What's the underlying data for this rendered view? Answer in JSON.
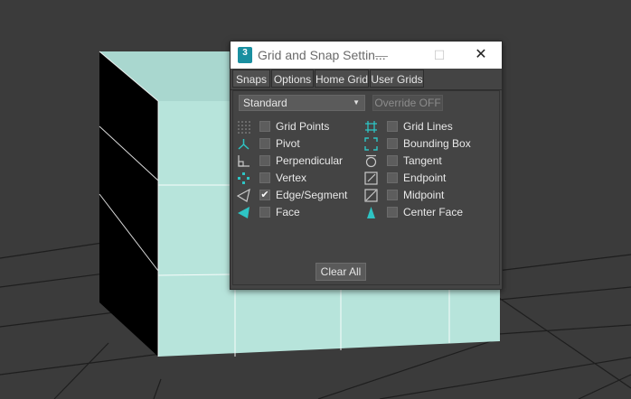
{
  "window": {
    "app_icon_text": "3",
    "title": "Grid and Snap Settin...",
    "minimize_glyph": "—",
    "maximize_glyph": "☐",
    "close_glyph": "✕"
  },
  "tabs": [
    {
      "label": "Snaps",
      "active": true
    },
    {
      "label": "Options",
      "active": false
    },
    {
      "label": "Home Grid",
      "active": false
    },
    {
      "label": "User Grids",
      "active": false
    }
  ],
  "snaps": {
    "preset": "Standard",
    "override_label": "Override OFF",
    "clear_label": "Clear All",
    "left": [
      {
        "label": "Grid Points",
        "checked": false,
        "icon": "grid-points-icon"
      },
      {
        "label": "Pivot",
        "checked": false,
        "icon": "pivot-icon"
      },
      {
        "label": "Perpendicular",
        "checked": false,
        "icon": "perpendicular-icon"
      },
      {
        "label": "Vertex",
        "checked": false,
        "icon": "vertex-icon"
      },
      {
        "label": "Edge/Segment",
        "checked": true,
        "icon": "edge-segment-icon"
      },
      {
        "label": "Face",
        "checked": false,
        "icon": "face-icon"
      }
    ],
    "right": [
      {
        "label": "Grid Lines",
        "checked": false,
        "icon": "grid-lines-icon"
      },
      {
        "label": "Bounding Box",
        "checked": false,
        "icon": "bounding-box-icon"
      },
      {
        "label": "Tangent",
        "checked": false,
        "icon": "tangent-icon"
      },
      {
        "label": "Endpoint",
        "checked": false,
        "icon": "endpoint-icon"
      },
      {
        "label": "Midpoint",
        "checked": false,
        "icon": "midpoint-icon"
      },
      {
        "label": "Center Face",
        "checked": false,
        "icon": "center-face-icon"
      }
    ],
    "check_glyph": "✔"
  },
  "colors": {
    "accent_teal": "#2ec4c4",
    "object_face": "#b5e3da",
    "viewport_bg": "#3b3b3b"
  }
}
